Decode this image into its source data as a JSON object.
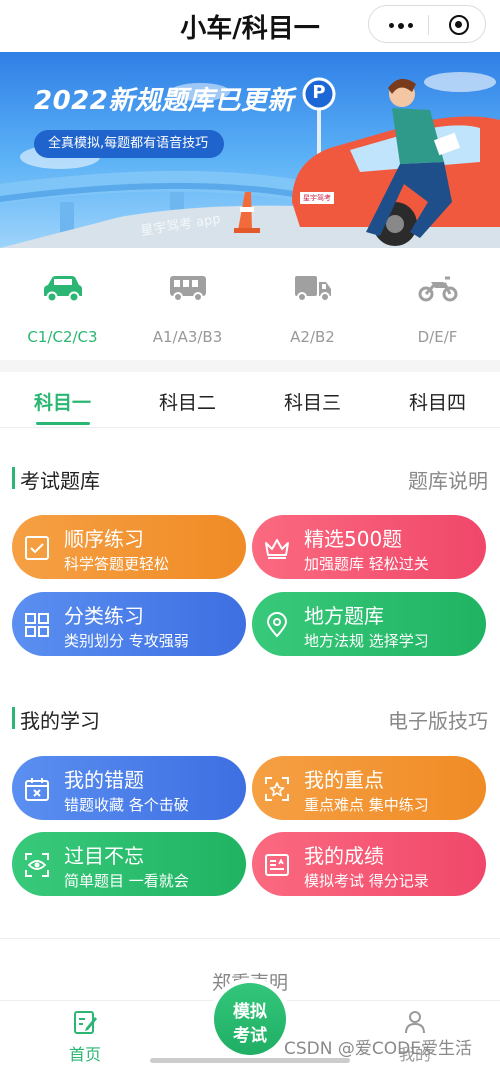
{
  "header": {
    "title": "小车/科目一",
    "more_icon": "more-dots-icon",
    "close_icon": "target-circle-icon"
  },
  "banner": {
    "title": "2022新规题库已更新",
    "subtitle": "全真模拟,每题都有语音技巧",
    "watermark": "星宇驾考 app",
    "sign": "P",
    "plate": "星宇驾考"
  },
  "vehicles": [
    {
      "label": "C1/C2/C3",
      "icon": "car-icon",
      "active": true
    },
    {
      "label": "A1/A3/B3",
      "icon": "bus-icon",
      "active": false
    },
    {
      "label": "A2/B2",
      "icon": "truck-icon",
      "active": false
    },
    {
      "label": "D/E/F",
      "icon": "motorcycle-icon",
      "active": false
    }
  ],
  "tabs": [
    {
      "label": "科目一",
      "active": true
    },
    {
      "label": "科目二",
      "active": false
    },
    {
      "label": "科目三",
      "active": false
    },
    {
      "label": "科目四",
      "active": false
    }
  ],
  "exam_section": {
    "title": "考试题库",
    "link": "题库说明",
    "cards": [
      {
        "title": "顺序练习",
        "subtitle": "科学答题更轻松",
        "icon": "checkbox-icon",
        "color": "#f29530"
      },
      {
        "title": "精选500题",
        "subtitle": "加强题库 轻松过关",
        "icon": "crown-icon",
        "color": "#f5556f"
      },
      {
        "title": "分类练习",
        "subtitle": "类别划分 专攻强弱",
        "icon": "grid-icon",
        "color": "#4a7ee8"
      },
      {
        "title": "地方题库",
        "subtitle": "地方法规 选择学习",
        "icon": "location-pin-icon",
        "color": "#27bc6b"
      }
    ]
  },
  "study_section": {
    "title": "我的学习",
    "link": "电子版技巧",
    "cards": [
      {
        "title": "我的错题",
        "subtitle": "错题收藏 各个击破",
        "icon": "calendar-x-icon",
        "color": "#4a7ee8"
      },
      {
        "title": "我的重点",
        "subtitle": "重点难点 集中练习",
        "icon": "star-focus-icon",
        "color": "#f29530"
      },
      {
        "title": "过目不忘",
        "subtitle": "简单题目 一看就会",
        "icon": "eye-icon",
        "color": "#27bc6b"
      },
      {
        "title": "我的成绩",
        "subtitle": "模拟考试 得分记录",
        "icon": "report-card-icon",
        "color": "#f5556f"
      }
    ]
  },
  "disclaimer": "郑重声明",
  "bottom_nav": {
    "home_label": "首页",
    "exam_line1": "模拟",
    "exam_line2": "考试",
    "profile_label": "我的"
  },
  "watermark": "CSDN @爱CODE爱生活",
  "colors": {
    "accent": "#2bb673",
    "banner": "#3d8ee8"
  }
}
